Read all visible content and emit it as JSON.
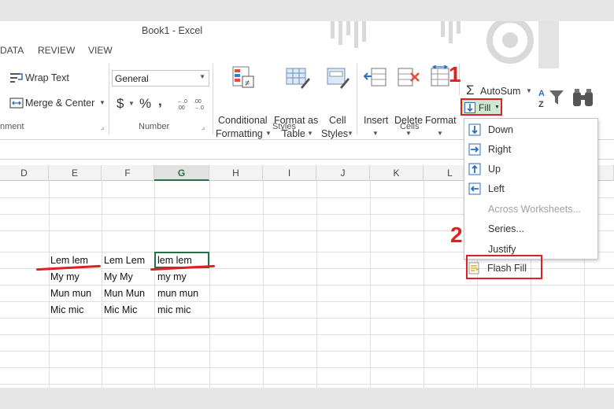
{
  "window": {
    "title": "Book1 - Excel"
  },
  "menu": {
    "tabs": [
      "DATA",
      "REVIEW",
      "VIEW"
    ]
  },
  "ribbon": {
    "alignment": {
      "wrap_text": "Wrap Text",
      "merge_center": "Merge & Center",
      "group_label": "nment"
    },
    "number": {
      "format_value": "General",
      "currency": "$",
      "percent": "%",
      "comma": ",",
      "group_label": "Number"
    },
    "styles": {
      "conditional_formatting_line1": "Conditional",
      "conditional_formatting_line2": "Formatting",
      "format_as_table_line1": "Format as",
      "format_as_table_line2": "Table",
      "cell_styles_line1": "Cell",
      "cell_styles_line2": "Styles",
      "group_label": "Styles"
    },
    "cells": {
      "insert": "Insert",
      "delete": "Delete",
      "format": "Format",
      "group_label": "Cells"
    },
    "editing": {
      "autosum": "AutoSum",
      "fill": "Fill"
    }
  },
  "fill_menu": {
    "items": [
      {
        "label": "Down",
        "enabled": true,
        "icon": "arrow-down-icon"
      },
      {
        "label": "Right",
        "enabled": true,
        "icon": "arrow-right-icon"
      },
      {
        "label": "Up",
        "enabled": true,
        "icon": "arrow-up-icon"
      },
      {
        "label": "Left",
        "enabled": true,
        "icon": "arrow-left-icon"
      },
      {
        "label": "Across Worksheets...",
        "enabled": false,
        "icon": ""
      },
      {
        "label": "Series...",
        "enabled": true,
        "icon": ""
      },
      {
        "label": "Justify",
        "enabled": true,
        "icon": ""
      },
      {
        "label": "Flash Fill",
        "enabled": true,
        "icon": "flash-fill-icon"
      }
    ]
  },
  "grid": {
    "columns": [
      "D",
      "E",
      "F",
      "G",
      "H",
      "I",
      "J",
      "K",
      "L"
    ],
    "selected_column": "G",
    "rows": [
      {
        "E": "Lem lem",
        "F": "Lem Lem",
        "G": "lem lem"
      },
      {
        "E": "My my",
        "F": "My My",
        "G": "my my"
      },
      {
        "E": "Mun mun",
        "F": "Mun Mun",
        "G": "mun mun"
      },
      {
        "E": "Mic mic",
        "F": "Mic Mic",
        "G": "mic mic"
      }
    ]
  },
  "annotations": {
    "step1": "1",
    "step2": "2"
  },
  "colors": {
    "accent_green": "#217346",
    "highlight_red": "#e02020",
    "fill_button_bg": "#cfe8d3"
  }
}
